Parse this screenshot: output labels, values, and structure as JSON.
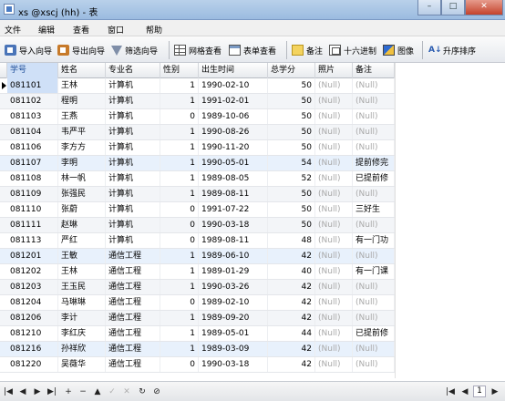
{
  "window": {
    "title": "xs @xscj (hh) - 表",
    "minimize": "–",
    "maximize": "□",
    "close": "✕"
  },
  "menu": [
    "文件",
    "编辑",
    "查看",
    "窗口",
    "帮助"
  ],
  "toolbar": {
    "import": "导入向导",
    "export": "导出向导",
    "filter": "筛选向导",
    "grid_view": "网格查看",
    "form_view": "表单查看",
    "memo": "备注",
    "hex": "十六进制",
    "image": "图像",
    "sort": "升序排序",
    "sort_icon": "A↓"
  },
  "table": {
    "columns": [
      "学号",
      "姓名",
      "专业名",
      "性别",
      "出生时间",
      "总学分",
      "照片",
      "备注"
    ],
    "rows": [
      [
        "081101",
        "王林",
        "计算机",
        "1",
        "1990-02-10",
        "50",
        "(Null)",
        "(Null)"
      ],
      [
        "081102",
        "程明",
        "计算机",
        "1",
        "1991-02-01",
        "50",
        "(Null)",
        "(Null)"
      ],
      [
        "081103",
        "王燕",
        "计算机",
        "0",
        "1989-10-06",
        "50",
        "(Null)",
        "(Null)"
      ],
      [
        "081104",
        "韦严平",
        "计算机",
        "1",
        "1990-08-26",
        "50",
        "(Null)",
        "(Null)"
      ],
      [
        "081106",
        "李方方",
        "计算机",
        "1",
        "1990-11-20",
        "50",
        "(Null)",
        "(Null)"
      ],
      [
        "081107",
        "李明",
        "计算机",
        "1",
        "1990-05-01",
        "54",
        "(Null)",
        "提前修完"
      ],
      [
        "081108",
        "林一帆",
        "计算机",
        "1",
        "1989-08-05",
        "52",
        "(Null)",
        "已提前修"
      ],
      [
        "081109",
        "张强民",
        "计算机",
        "1",
        "1989-08-11",
        "50",
        "(Null)",
        "(Null)"
      ],
      [
        "081110",
        "张蔚",
        "计算机",
        "0",
        "1991-07-22",
        "50",
        "(Null)",
        "三好生"
      ],
      [
        "081111",
        "赵琳",
        "计算机",
        "0",
        "1990-03-18",
        "50",
        "(Null)",
        "(Null)"
      ],
      [
        "081113",
        "严红",
        "计算机",
        "0",
        "1989-08-11",
        "48",
        "(Null)",
        "有一门功"
      ],
      [
        "081201",
        "王敏",
        "通信工程",
        "1",
        "1989-06-10",
        "42",
        "(Null)",
        "(Null)"
      ],
      [
        "081202",
        "王林",
        "通信工程",
        "1",
        "1989-01-29",
        "40",
        "(Null)",
        "有一门课"
      ],
      [
        "081203",
        "王玉民",
        "通信工程",
        "1",
        "1990-03-26",
        "42",
        "(Null)",
        "(Null)"
      ],
      [
        "081204",
        "马琳琳",
        "通信工程",
        "0",
        "1989-02-10",
        "42",
        "(Null)",
        "(Null)"
      ],
      [
        "081206",
        "李计",
        "通信工程",
        "1",
        "1989-09-20",
        "42",
        "(Null)",
        "(Null)"
      ],
      [
        "081210",
        "李红庆",
        "通信工程",
        "1",
        "1989-05-01",
        "44",
        "(Null)",
        "已提前修"
      ],
      [
        "081216",
        "孙祥欣",
        "通信工程",
        "1",
        "1989-03-09",
        "42",
        "(Null)",
        "(Null)"
      ],
      [
        "081220",
        "吴薇华",
        "通信工程",
        "0",
        "1990-03-18",
        "42",
        "(Null)",
        "(Null)"
      ]
    ]
  },
  "statusbar": {
    "first": "|◀",
    "prev": "◀",
    "next": "▶",
    "last": "▶|",
    "add": "+",
    "delete": "−",
    "up": "▲",
    "check": "✓",
    "cancel": "✕",
    "refresh": "↻",
    "stop": "⊘",
    "page_first": "|◀",
    "page_prev": "◀",
    "page": "1",
    "page_next": "▶"
  }
}
